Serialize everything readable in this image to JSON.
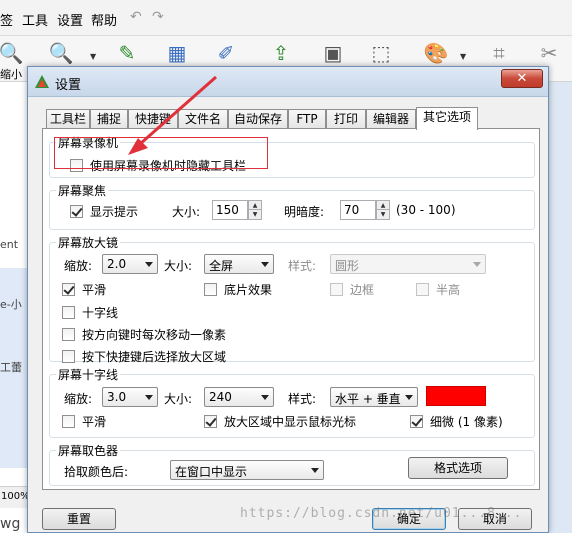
{
  "app": {
    "menu": [
      "签",
      "工具",
      "设置",
      "帮助"
    ],
    "toolbar_label": "缩小",
    "side_texts": [
      "ent",
      "e-小",
      "工蕾",
      "wg"
    ],
    "status": "100%"
  },
  "dialog": {
    "title": "设置",
    "close_label": "✕",
    "tabs": [
      "工具栏",
      "捕捉",
      "快捷键",
      "文件名",
      "自动保存",
      "FTP",
      "打印",
      "编辑器",
      "其它选项"
    ],
    "active_tab": 8,
    "groups": {
      "recorder": {
        "title": "屏幕录像机",
        "hide_toolbar": {
          "label": "使用屏幕录像机时隐藏工具栏",
          "checked": false
        }
      },
      "focus": {
        "title": "屏幕聚焦",
        "show_hint": {
          "label": "显示提示",
          "checked": true
        },
        "size_label": "大小:",
        "size_value": "150",
        "dim_label": "明暗度:",
        "dim_value": "70",
        "range": "(30 - 100)"
      },
      "magnifier": {
        "title": "屏幕放大镜",
        "zoom_label": "缩放:",
        "zoom_value": "2.0",
        "size_label": "大小:",
        "size_value": "全屏",
        "style_label": "样式:",
        "style_value": "圆形",
        "smooth": {
          "label": "平滑",
          "checked": true
        },
        "negative": {
          "label": "底片效果",
          "checked": false
        },
        "border": {
          "label": "边框",
          "checked": false
        },
        "half_height": {
          "label": "半高",
          "checked": false
        },
        "crosshair": {
          "label": "十字线",
          "checked": false
        },
        "move_pixel": {
          "label": "按方向键时每次移动一像素",
          "checked": false
        },
        "select_large": {
          "label": "按下快捷键后选择放大区域",
          "checked": false
        }
      },
      "crosshair": {
        "title": "屏幕十字线",
        "zoom_label": "缩放:",
        "zoom_value": "3.0",
        "size_label": "大小:",
        "size_value": "240",
        "style_label": "样式:",
        "style_value": "水平 + 垂直",
        "color": "#ff0000",
        "smooth": {
          "label": "平滑",
          "checked": false
        },
        "show_cursor": {
          "label": "放大区域中显示鼠标光标",
          "checked": true
        },
        "thin": {
          "label": "细微 (1 像素)",
          "checked": true
        }
      },
      "picker": {
        "title": "屏幕取色器",
        "after_label": "拾取颜色后:",
        "after_value": "在窗口中显示",
        "format_button": "格式选项"
      }
    },
    "buttons": {
      "reset": "重置",
      "ok": "确定",
      "cancel": "取消"
    }
  },
  "annotation": {
    "color": "#e0303a"
  },
  "watermark": "https://blog.csdn.net/u01...8..."
}
